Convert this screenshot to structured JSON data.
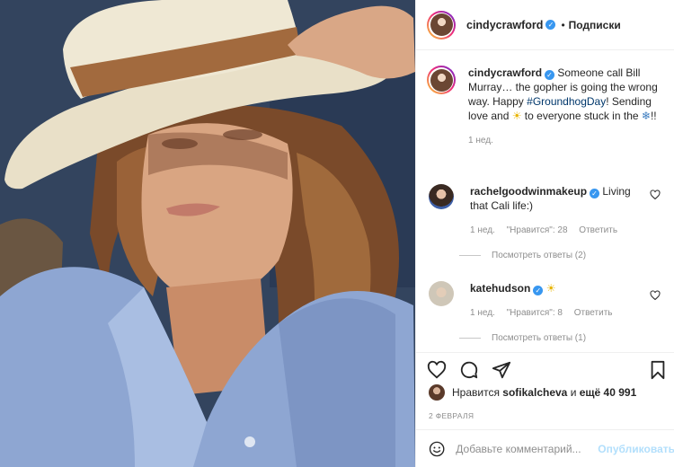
{
  "post": {
    "author": "cindycrawford",
    "follow_status": "Подписки",
    "separator": "•"
  },
  "caption": {
    "author": "cindycrawford",
    "text_part1": "Someone call Bill Murray… the gopher is going the wrong way. Happy ",
    "hashtag": "#GroundhogDay",
    "text_part2": "! Sending love and ",
    "text_part3": " to everyone stuck in the ",
    "text_part4": "!!",
    "time": "1 нед."
  },
  "comments": [
    {
      "author": "rachelgoodwinmakeup",
      "text": "Living that Cali life:)",
      "time": "1 нед.",
      "likes": "\"Нравится\": 28",
      "reply": "Ответить",
      "replies_label": "Посмотреть ответы (2)"
    },
    {
      "author": "katehudson",
      "text": "",
      "time": "1 нед.",
      "likes": "\"Нравится\": 8",
      "reply": "Ответить",
      "replies_label": "Посмотреть ответы (1)"
    }
  ],
  "likes": {
    "prefix": "Нравится",
    "user": "sofikalcheva",
    "middle": "и",
    "others": "ещё 40 991"
  },
  "date": "2 ФЕВРАЛЯ",
  "add_comment": {
    "placeholder": "Добавьте комментарий...",
    "publish": "Опубликовать"
  },
  "icons": {
    "like": "heart-icon",
    "comment": "comment-bubble-icon",
    "share": "paper-plane-icon",
    "save": "bookmark-icon",
    "emoji": "smiley-icon",
    "verified": "verified-badge-icon",
    "sun": "sun-emoji-icon",
    "snowflake": "snowflake-emoji-icon"
  },
  "colors": {
    "verified": "#3897f0",
    "hashtag": "#00376b",
    "publish_disabled": "#b2dffc",
    "muted": "#8e8e8e",
    "text": "#262626"
  }
}
